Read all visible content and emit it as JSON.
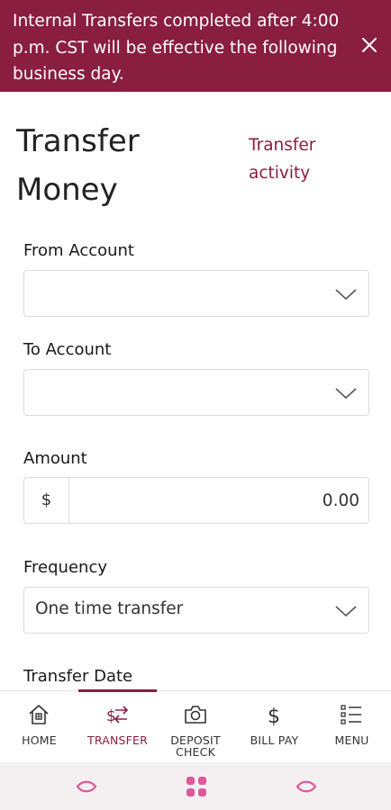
{
  "banner": {
    "message": "Internal Transfers completed after 4:00 p.m. CST will be effective the following business day."
  },
  "header": {
    "title": "Transfer Money",
    "activity_link": "Transfer activity"
  },
  "form": {
    "from_account": {
      "label": "From Account",
      "value": ""
    },
    "to_account": {
      "label": "To Account",
      "value": ""
    },
    "amount": {
      "label": "Amount",
      "prefix": "$",
      "value": "0.00"
    },
    "frequency": {
      "label": "Frequency",
      "value": "One time transfer"
    },
    "transfer_date": {
      "label": "Transfer Date"
    }
  },
  "nav": {
    "items": [
      {
        "label": "HOME",
        "icon": "home-icon"
      },
      {
        "label": "TRANSFER",
        "icon": "transfer-icon",
        "active": true
      },
      {
        "label": "DEPOSIT CHECK",
        "icon": "camera-icon"
      },
      {
        "label": "BILL PAY",
        "icon": "dollar-icon"
      },
      {
        "label": "MENU",
        "icon": "menu-list-icon"
      }
    ]
  },
  "colors": {
    "brand": "#8a1e40",
    "system_button": "#e0579a"
  }
}
